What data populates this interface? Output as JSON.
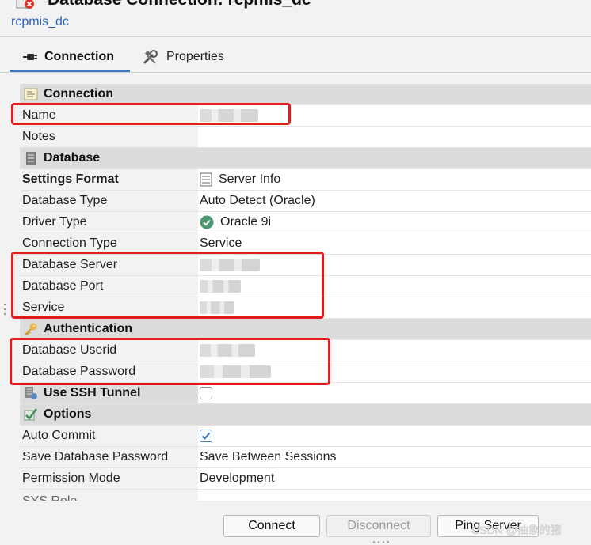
{
  "window": {
    "title": "Database Connection: rcpmis_dc"
  },
  "connection_name_link": "rcpmis_dc",
  "tabs": [
    {
      "label": "Connection",
      "icon": "plug-icon",
      "active": true
    },
    {
      "label": "Properties",
      "icon": "wrench-icon",
      "active": false
    }
  ],
  "sections": {
    "connection": {
      "title": "Connection",
      "name_label": "Name",
      "notes_label": "Notes"
    },
    "database": {
      "title": "Database",
      "settings_format_label": "Settings Format",
      "settings_format_value": "Server Info",
      "database_type_label": "Database Type",
      "database_type_value": "Auto Detect (Oracle)",
      "driver_type_label": "Driver Type",
      "driver_type_value": "Oracle 9i",
      "connection_type_label": "Connection Type",
      "connection_type_value": "Service",
      "database_server_label": "Database Server",
      "database_port_label": "Database Port",
      "service_label": "Service"
    },
    "authentication": {
      "title": "Authentication",
      "userid_label": "Database Userid",
      "password_label": "Database Password"
    },
    "ssh": {
      "title": "Use SSH Tunnel",
      "checked": false
    },
    "options": {
      "title": "Options",
      "auto_commit_label": "Auto Commit",
      "auto_commit_checked": true,
      "save_password_label": "Save Database Password",
      "save_password_value": "Save Between Sessions",
      "permission_mode_label": "Permission Mode",
      "permission_mode_value": "Development",
      "partial_label": "SYS Role"
    }
  },
  "buttons": {
    "connect": "Connect",
    "disconnect": "Disconnect",
    "ping": "Ping Server"
  },
  "watermark": "CSDN @抽象的猪",
  "colors": {
    "accent": "#3a78c8",
    "highlight_box": "#e31d1d",
    "section_bg": "#dcdcdc",
    "link": "#2a64b8"
  }
}
